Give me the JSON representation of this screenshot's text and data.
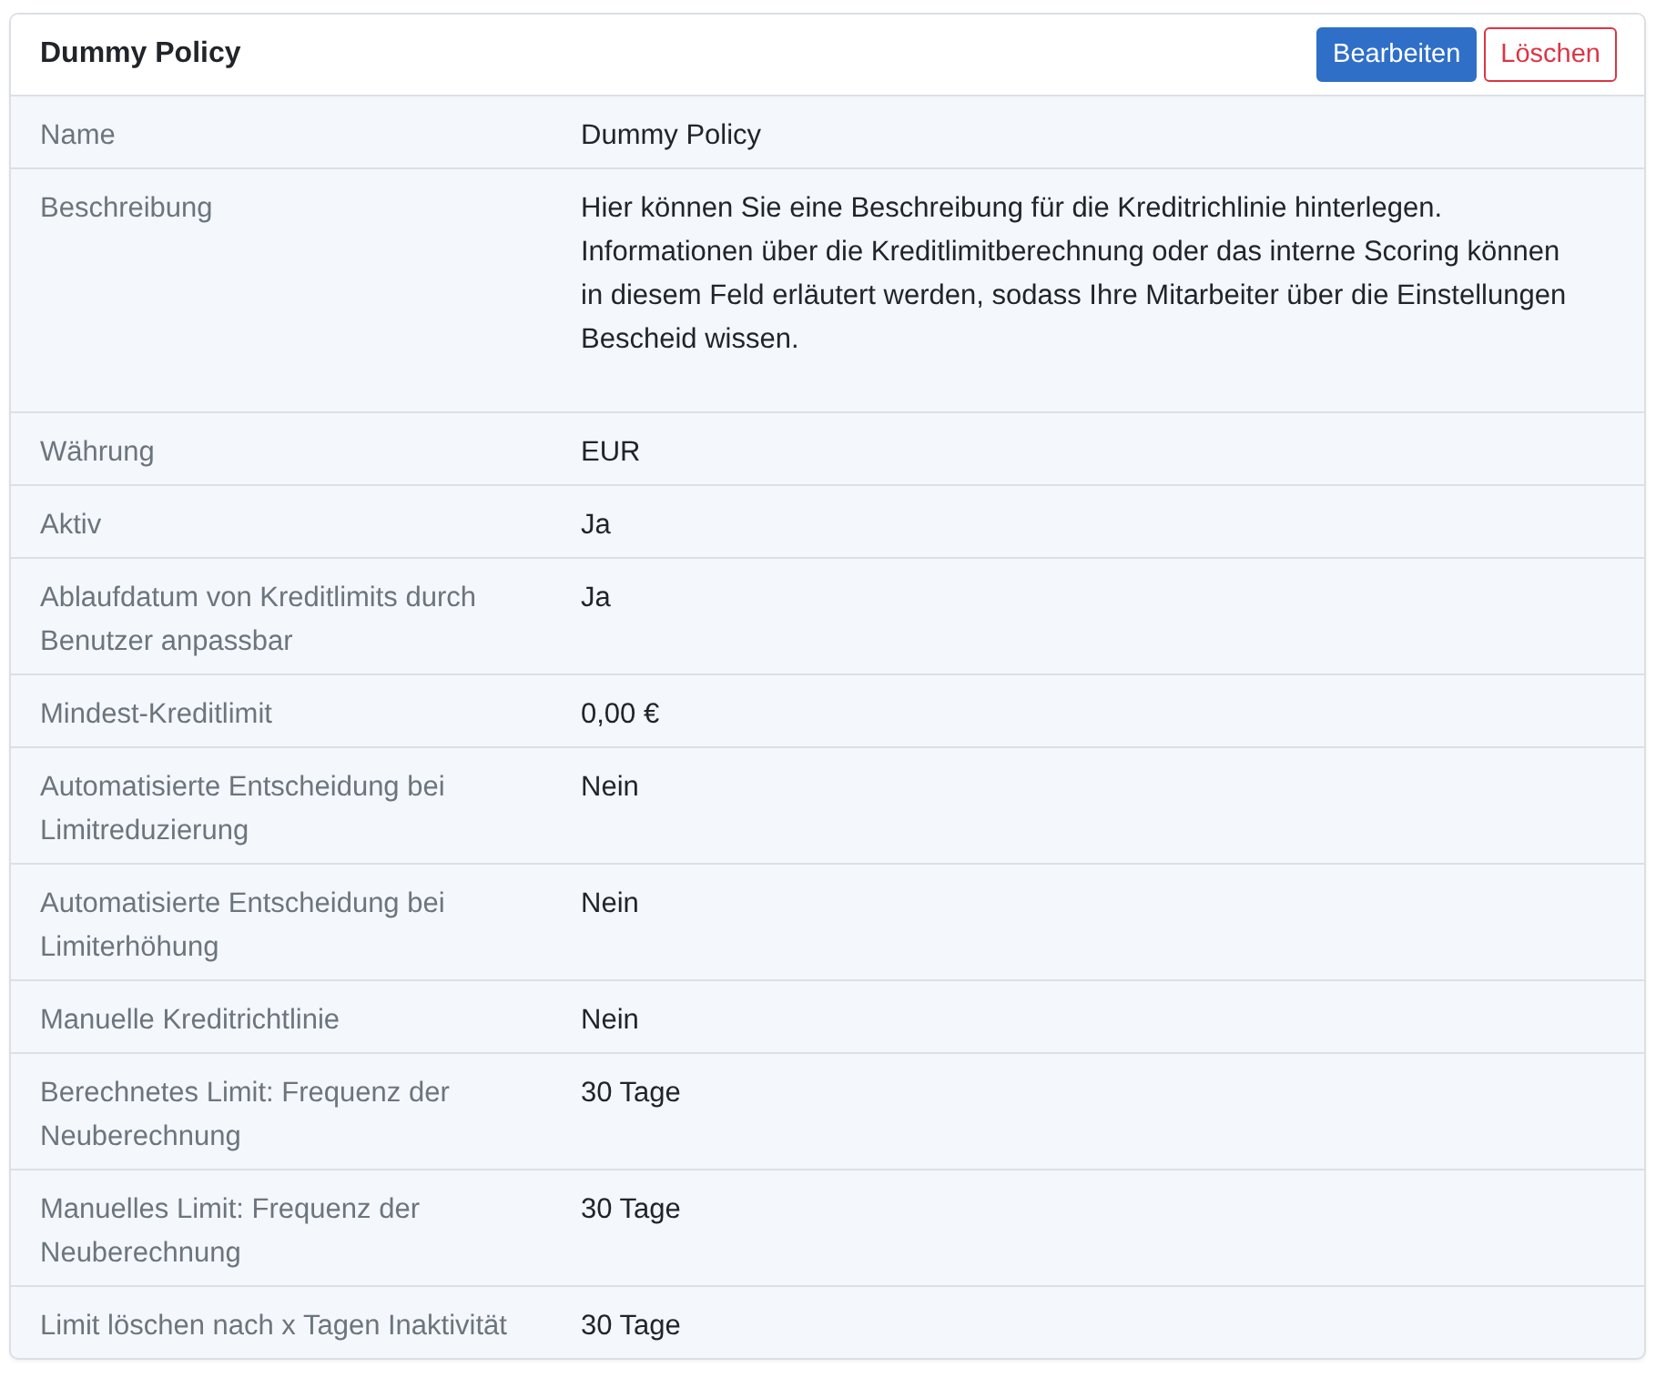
{
  "card": {
    "title": "Dummy Policy",
    "buttons": [
      {
        "label": "Bearbeiten",
        "kind": "primary"
      },
      {
        "label": "Löschen",
        "kind": "danger"
      }
    ]
  },
  "rows": [
    {
      "label": "Name",
      "value": "Dummy Policy"
    },
    {
      "label": "Beschreibung",
      "value": "Hier können Sie eine Beschreibung für die Kreditrichlinie hinterlegen. Informationen über die Kreditlimitberechnung oder das interne Scoring können in diesem Feld erläutert werden, sodass Ihre Mitarbeiter über die Einstellungen Bescheid wissen."
    },
    {
      "label": "Währung",
      "value": "EUR"
    },
    {
      "label": "Aktiv",
      "value": "Ja"
    },
    {
      "label": "Ablaufdatum von Kreditlimits durch Benutzer anpassbar",
      "value": "Ja"
    },
    {
      "label": "Mindest-Kreditlimit",
      "value": "0,00 €"
    },
    {
      "label": "Automatisierte Entscheidung bei Limitreduzierung",
      "value": "Nein"
    },
    {
      "label": "Automatisierte Entscheidung bei Limiterhöhung",
      "value": "Nein"
    },
    {
      "label": "Manuelle Kreditrichtlinie",
      "value": "Nein"
    },
    {
      "label": "Berechnetes Limit: Frequenz der Neuberechnung",
      "value": "30 Tage"
    },
    {
      "label": "Manuelles Limit: Frequenz der Neuberechnung",
      "value": "30 Tage"
    },
    {
      "label": "Limit löschen nach x Tagen Inaktivität",
      "value": "30 Tage"
    }
  ]
}
